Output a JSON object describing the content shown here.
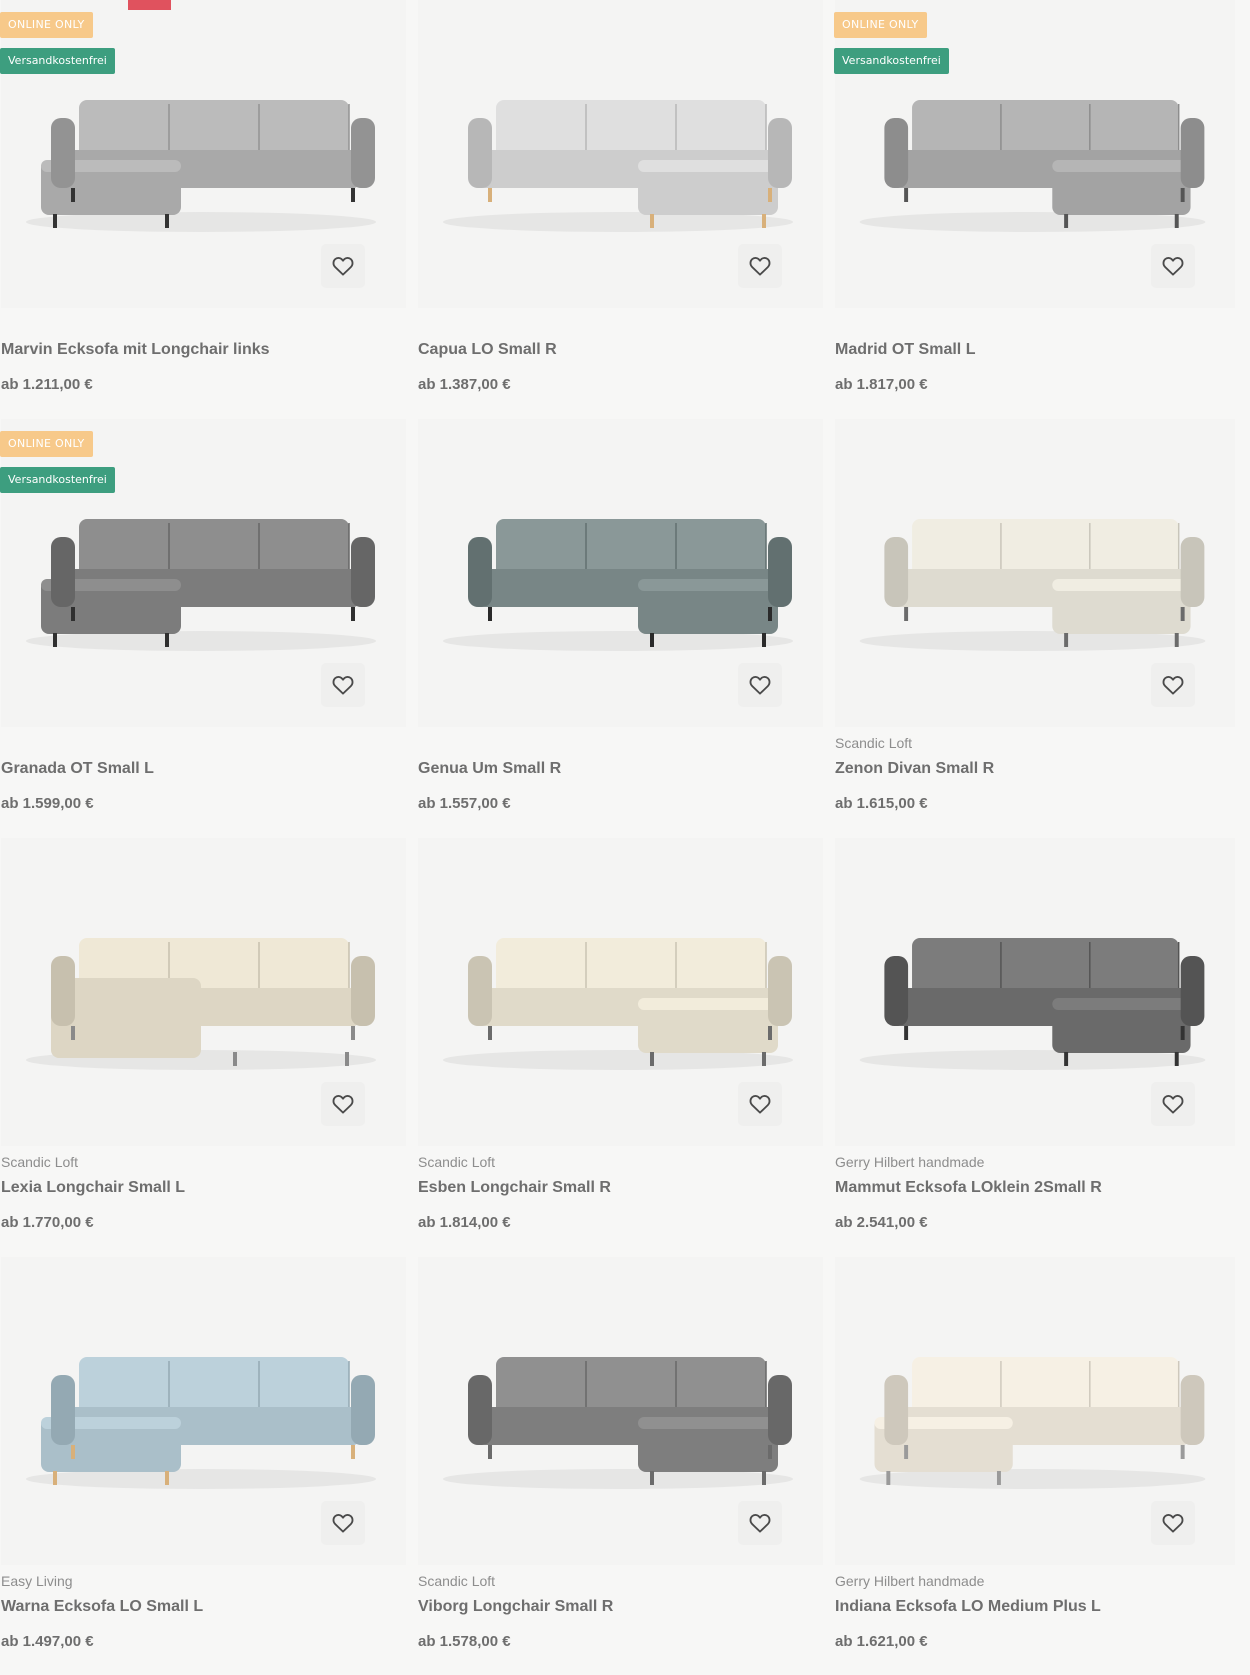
{
  "badges": {
    "online_only": "ONLINE ONLY",
    "free_shipping": "Versandkostenfrei"
  },
  "colors": {
    "online_badge": "#f7c98a",
    "shipping_badge": "#3d9e7f",
    "accent_tab": "#e0525e"
  },
  "products": [
    {
      "name": "Marvin Ecksofa mit Longchair links",
      "price": "ab 1.211,00 €",
      "brand": "",
      "online_only": true,
      "free_shipping": true,
      "sofa_color": "#a9a9a9",
      "leg_color": "#333333",
      "shape": "L-left"
    },
    {
      "name": "Capua LO Small R",
      "price": "ab 1.387,00 €",
      "brand": "",
      "online_only": false,
      "free_shipping": false,
      "sofa_color": "#cdcdcd",
      "leg_color": "#d8b07a",
      "shape": "L-right"
    },
    {
      "name": "Madrid OT Small L",
      "price": "ab 1.817,00 €",
      "brand": "",
      "online_only": true,
      "free_shipping": true,
      "sofa_color": "#a3a3a3",
      "leg_color": "#555555",
      "shape": "L-right"
    },
    {
      "name": "Granada OT Small L",
      "price": "ab 1.599,00 €",
      "brand": "",
      "online_only": true,
      "free_shipping": true,
      "sofa_color": "#7c7c7c",
      "leg_color": "#2f2f2f",
      "shape": "L-left"
    },
    {
      "name": "Genua Um Small R",
      "price": "ab 1.557,00 €",
      "brand": "",
      "online_only": false,
      "free_shipping": false,
      "sofa_color": "#788686",
      "leg_color": "#2a2a2a",
      "shape": "L-right"
    },
    {
      "name": "Zenon Divan Small R",
      "price": "ab 1.615,00 €",
      "brand": "Scandic Loft",
      "online_only": false,
      "free_shipping": false,
      "sofa_color": "#dedbd0",
      "leg_color": "#6b6b6b",
      "shape": "L-right"
    },
    {
      "name": "Lexia Longchair Small L",
      "price": "ab 1.770,00 €",
      "brand": "Scandic Loft",
      "online_only": false,
      "free_shipping": false,
      "sofa_color": "#ddd6c4",
      "leg_color": "#8a8a8a",
      "shape": "U"
    },
    {
      "name": "Esben Longchair Small R",
      "price": "ab 1.814,00 €",
      "brand": "Scandic Loft",
      "online_only": false,
      "free_shipping": false,
      "sofa_color": "#e0dac9",
      "leg_color": "#6b6b6b",
      "shape": "L-right"
    },
    {
      "name": "Mammut Ecksofa LOklein 2Small R",
      "price": "ab 2.541,00 €",
      "brand": "Gerry Hilbert handmade",
      "online_only": false,
      "free_shipping": false,
      "sofa_color": "#6a6a6a",
      "leg_color": "#333333",
      "shape": "L-right"
    },
    {
      "name": "Warna Ecksofa LO Small L",
      "price": "ab 1.497,00 €",
      "brand": "Easy Living",
      "online_only": false,
      "free_shipping": false,
      "sofa_color": "#aabfc9",
      "leg_color": "#d8b07a",
      "shape": "L-left"
    },
    {
      "name": "Viborg Longchair Small R",
      "price": "ab 1.578,00 €",
      "brand": "Scandic Loft",
      "online_only": false,
      "free_shipping": false,
      "sofa_color": "#7e7e7e",
      "leg_color": "#6b6b6b",
      "shape": "L-right"
    },
    {
      "name": "Indiana Ecksofa LO Medium Plus L",
      "price": "ab 1.621,00 €",
      "brand": "Gerry Hilbert handmade",
      "online_only": false,
      "free_shipping": false,
      "sofa_color": "#e4ded2",
      "leg_color": "#9a9a9a",
      "shape": "L-left"
    }
  ]
}
